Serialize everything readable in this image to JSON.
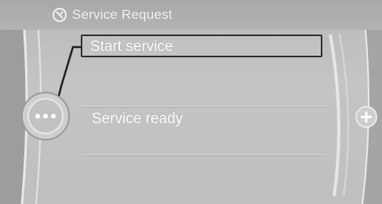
{
  "header": {
    "title": "Service Request",
    "icon": "service-wrench-icon"
  },
  "menu": {
    "items": [
      {
        "label": "Start service",
        "selected": true
      },
      {
        "label": "Service ready",
        "selected": false
      }
    ]
  },
  "controller": {
    "left_knob_icon": "controller-knob-icon",
    "right_button_icon": "plus-icon"
  },
  "colors": {
    "background": "#bfbfbf",
    "text": "#ffffff",
    "selection_border": "#2d2d2d"
  }
}
